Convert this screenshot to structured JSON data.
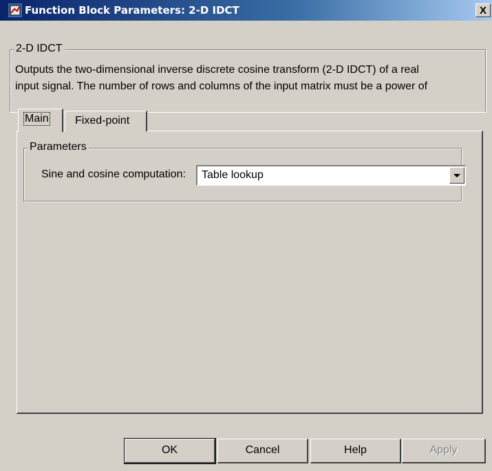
{
  "window": {
    "title": "Function Block Parameters: 2-D IDCT",
    "close_label": "X"
  },
  "block": {
    "group_label": "2-D IDCT",
    "description_line1": "Outputs the two-dimensional inverse discrete cosine transform (2-D IDCT) of a real",
    "description_line2": "input signal. The number of rows and columns of the input matrix must be a power of"
  },
  "tabs": [
    {
      "label": "Main",
      "selected": true
    },
    {
      "label": "Fixed-point",
      "selected": false
    }
  ],
  "parameters": {
    "group_label": "Parameters",
    "sine_cosine_label": "Sine and cosine computation:",
    "sine_cosine_value": "Table lookup"
  },
  "buttons": {
    "ok": "OK",
    "cancel": "Cancel",
    "help": "Help",
    "apply": "Apply"
  }
}
